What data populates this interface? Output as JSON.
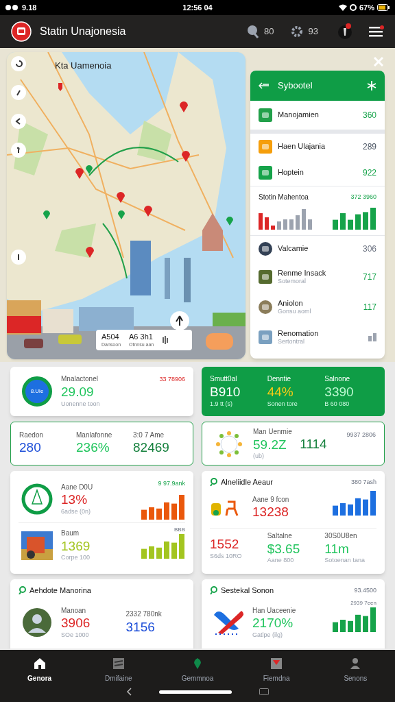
{
  "status_bar": {
    "time_left": "9.18",
    "time_center": "12:56 04",
    "battery": "67%"
  },
  "header": {
    "title": "Statin Unajonesia",
    "search_count": "80",
    "settings_count": "93"
  },
  "map": {
    "title": "Kta Uamenoia",
    "info": [
      {
        "value": "A504",
        "label": "Dansoon"
      },
      {
        "value": "A6 3h1",
        "label": "Otnnsu aan"
      }
    ]
  },
  "side_panel": {
    "title": "Sybootel",
    "items": [
      {
        "kind": "item",
        "label": "Manojamien",
        "value": "360",
        "color": "#16a34a"
      },
      {
        "kind": "item",
        "label": "Haen Ulajania",
        "value": "289",
        "color": "#4b5563"
      },
      {
        "kind": "item",
        "label": "Hoptein",
        "value": "922",
        "color": "#16a34a"
      },
      {
        "kind": "chart",
        "label": "Stotin Mahentoa",
        "value": "372 3960"
      },
      {
        "kind": "item",
        "label": "Valcamie",
        "value": "306",
        "color": "#6b7280"
      },
      {
        "kind": "item",
        "label": "Renme Insack",
        "sub": "Sotemoral",
        "value": "717",
        "color": "#16a34a"
      },
      {
        "kind": "item",
        "label": "Aniolon",
        "sub": "Gonsu aoml",
        "value": "117",
        "color": "#16a34a"
      },
      {
        "kind": "bars",
        "label": "Renomation",
        "sub": "Sertontral"
      }
    ]
  },
  "cards": [
    {
      "sections": [
        {
          "visual_text": "8.Ule",
          "corner": "33 78906",
          "metrics": [
            {
              "label": "Mnalactonel",
              "value": "29.09",
              "sub": "Uonenne toon",
              "color": "#22c55e"
            }
          ]
        }
      ]
    },
    {
      "sections": [
        {
          "metrics": [
            {
              "label": "Smutt0al",
              "value": "B910",
              "sub": "1.9 tt (s)",
              "color": "#ffffff"
            },
            {
              "label": "Denntie",
              "value": "44%",
              "sub": "Sonen tore",
              "color": "#facc15"
            },
            {
              "label": "Salnone",
              "value": "3390",
              "sub": "B 60 080",
              "color": "#bbf7d0"
            }
          ]
        }
      ]
    },
    {
      "sections": [
        {
          "metrics": [
            {
              "label": "Raedon",
              "value": "280",
              "color": "#1d4ed8"
            },
            {
              "label": "Manlafonne",
              "value": "236%",
              "color": "#22c55e"
            },
            {
              "label": "3:0 7 Ame",
              "value": "82469",
              "color": "#15803d"
            }
          ]
        }
      ]
    },
    {
      "sections": [
        {
          "corner": "9937 2806",
          "metrics": [
            {
              "label": "Man Uenmie",
              "value": "59.2Z",
              "sub": "(ub)",
              "color": "#22c55e"
            },
            {
              "value": "1114",
              "color": "#15803d"
            }
          ]
        }
      ]
    },
    {
      "sections": [
        {
          "corner": "9 97.9ank",
          "chart": {
            "color": "#ea580c"
          },
          "metrics": [
            {
              "label": "Aane D0U",
              "value": "13%",
              "sub": "6adse (0n)",
              "color": "#dc2626"
            }
          ]
        },
        {
          "chart": {
            "color": "#a3c520",
            "label": "BBB"
          },
          "metrics": [
            {
              "label": "Baum",
              "value": "1369",
              "sub": "Corpe 100",
              "color": "#a3c520"
            }
          ]
        }
      ]
    },
    {
      "title": "Alneliidle Aeaur",
      "corner": "380 7ash",
      "sections": [
        {
          "chart": {
            "color": "#1d6fe0"
          },
          "metrics": [
            {
              "label": "Aane 9 fcon",
              "value": "13238",
              "color": "#dc2626"
            }
          ]
        },
        {
          "metrics": [
            {
              "value": "1552",
              "sub": "S6ds 10RO",
              "color": "#dc2626"
            },
            {
              "label": "Saltalne",
              "value": "$3.65",
              "sub": "Aane 800",
              "color": "#22c55e"
            },
            {
              "label": "30S0U8en",
              "value": "11m",
              "sub": "Sotoenan tana",
              "color": "#22c55e"
            }
          ]
        }
      ]
    },
    {
      "title": "Aehdote Manorina",
      "sections": [
        {
          "metrics": [
            {
              "label": "Manoan",
              "value": "3906",
              "sub": "SOe 1000",
              "color": "#dc2626"
            },
            {
              "label": "2332 780nk",
              "value": "3156",
              "color": "#1d4ed8"
            }
          ]
        }
      ]
    },
    {
      "title": "Sestekal Sonon",
      "corner": "93.4500",
      "sections": [
        {
          "chart": {
            "color": "#16a34a",
            "label": "2939 7een"
          },
          "metrics": [
            {
              "label": "Han Uaceenie",
              "value": "2170%",
              "sub": "Gatlpe (ilg)",
              "color": "#22c55e"
            }
          ]
        }
      ]
    }
  ],
  "bottom_nav": [
    {
      "label": "Genora",
      "selected": true
    },
    {
      "label": "Dmifaine",
      "selected": false
    },
    {
      "label": "Gemmnoa",
      "selected": false
    },
    {
      "label": "Fiemdna",
      "selected": false
    },
    {
      "label": "Senons",
      "selected": false
    }
  ]
}
